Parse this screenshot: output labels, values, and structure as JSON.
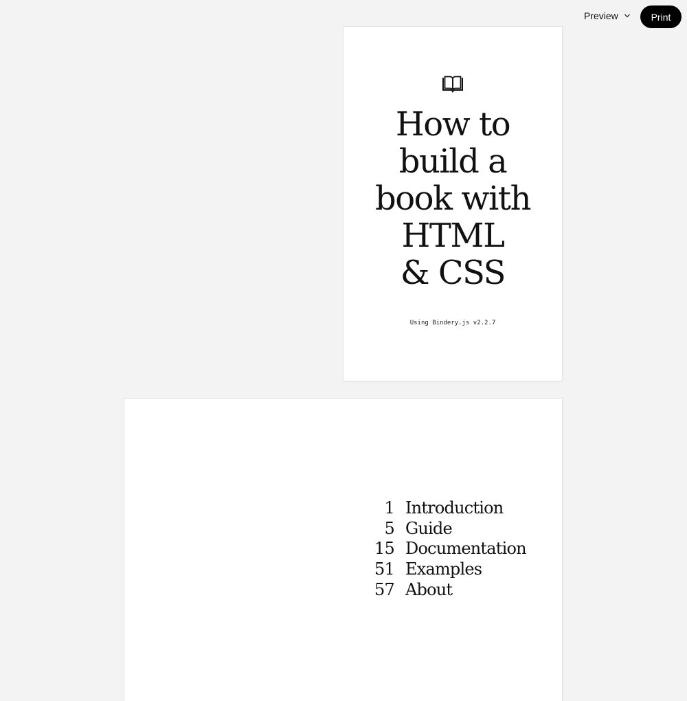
{
  "toolbar": {
    "preview_label": "Preview",
    "preview_icon": "chevron-down-icon",
    "print_label": "Print"
  },
  "cover": {
    "icon": "open-book-icon",
    "title_lines": [
      "How to",
      "build a",
      "book with",
      "HTML",
      "& CSS"
    ],
    "subtitle": "Using Bindery.js v2.2.7"
  },
  "toc": {
    "items": [
      {
        "page": "1",
        "title": "Introduction"
      },
      {
        "page": "5",
        "title": "Guide"
      },
      {
        "page": "15",
        "title": "Documentation"
      },
      {
        "page": "51",
        "title": "Examples"
      },
      {
        "page": "57",
        "title": "About"
      }
    ]
  }
}
